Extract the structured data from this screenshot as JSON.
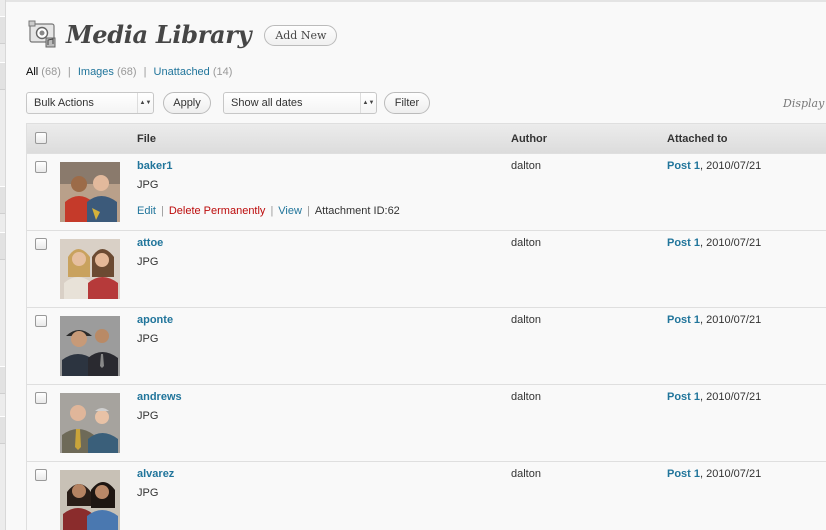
{
  "header": {
    "title": "Media Library",
    "add_new_label": "Add New",
    "icon": "media-library-icon"
  },
  "filters": {
    "all": {
      "label": "All",
      "count": "(68)"
    },
    "images": {
      "label": "Images",
      "count": "(68)"
    },
    "unattached": {
      "label": "Unattached",
      "count": "(14)"
    },
    "separator": "|"
  },
  "toolbar": {
    "bulk_actions_value": "Bulk Actions",
    "apply_label": "Apply",
    "dates_value": "Show all dates",
    "filter_label": "Filter",
    "display_text": "Display"
  },
  "table": {
    "columns": {
      "file": "File",
      "author": "Author",
      "attached_to": "Attached to"
    },
    "rows": [
      {
        "name": "baker1",
        "type": "JPG",
        "author": "dalton",
        "post": "Post 1",
        "date": ", 2010/07/21",
        "actions": {
          "edit": "Edit",
          "delete": "Delete Permanently",
          "view": "View",
          "id": "Attachment ID:62"
        }
      },
      {
        "name": "attoe",
        "type": "JPG",
        "author": "dalton",
        "post": "Post 1",
        "date": ", 2010/07/21"
      },
      {
        "name": "aponte",
        "type": "JPG",
        "author": "dalton",
        "post": "Post 1",
        "date": ", 2010/07/21"
      },
      {
        "name": "andrews",
        "type": "JPG",
        "author": "dalton",
        "post": "Post 1",
        "date": ", 2010/07/21"
      },
      {
        "name": "alvarez",
        "type": "JPG",
        "author": "dalton",
        "post": "Post 1",
        "date": ", 2010/07/21"
      }
    ]
  },
  "colors": {
    "link": "#21759b",
    "delete": "#bc0b0b",
    "background": "#f9f9f9"
  }
}
